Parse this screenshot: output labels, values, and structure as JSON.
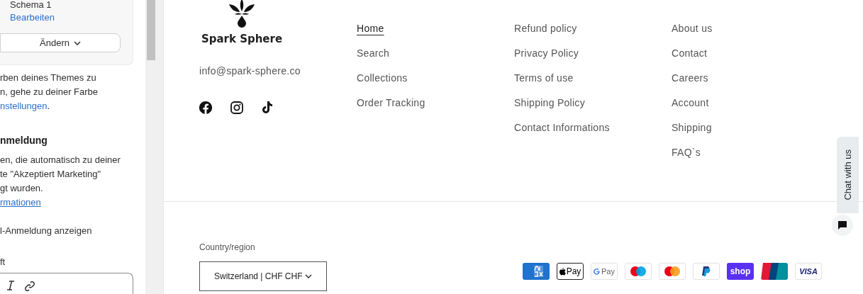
{
  "editor_panel": {
    "card": {
      "title": "Schema 1",
      "edit_link": "Bearbeiten",
      "change_button": "Ändern"
    },
    "paragraph_1": {
      "lines": [
        "rben deines Themes zu",
        "n, gehe zu deiner Farbe"
      ],
      "link": "nstellungen",
      "tail": "."
    },
    "heading": "nmeldung",
    "paragraph_2": {
      "lines": [
        "en, die automatisch zu deiner",
        "te \"Akzeptiert Marketing\"",
        "gt wurden."
      ],
      "link": "rmationen"
    },
    "option_label": "l-Anmeldung anzeigen",
    "field_label": "ft",
    "toolbar": [
      {
        "kind": "italic"
      },
      {
        "kind": "link"
      }
    ]
  },
  "footer": {
    "brand": "Spark Sphere",
    "email": "info@spark-sphere.co",
    "social": [
      {
        "kind": "facebook"
      },
      {
        "kind": "instagram"
      },
      {
        "kind": "tiktok"
      }
    ],
    "menus": [
      {
        "links": [
          {
            "label": "Home",
            "selected": true
          },
          {
            "label": "Search",
            "selected": false
          },
          {
            "label": "Collections",
            "selected": false
          },
          {
            "label": "Order Tracking",
            "selected": false
          }
        ]
      },
      {
        "links": [
          {
            "label": "Refund policy",
            "selected": false
          },
          {
            "label": "Privacy Policy",
            "selected": false
          },
          {
            "label": "Terms of use",
            "selected": false
          },
          {
            "label": "Shipping Policy",
            "selected": false
          },
          {
            "label": "Contact Informations",
            "selected": false
          }
        ]
      },
      {
        "links": [
          {
            "label": "About us",
            "selected": false
          },
          {
            "label": "Contact",
            "selected": false
          },
          {
            "label": "Careers",
            "selected": false
          },
          {
            "label": "Account",
            "selected": false
          },
          {
            "label": "Shipping",
            "selected": false
          },
          {
            "label": "FAQ`s",
            "selected": false
          }
        ]
      }
    ],
    "country_label": "Country/region",
    "country_value": "Switzerland | CHF CHF",
    "payments": [
      {
        "kind": "amex"
      },
      {
        "kind": "apple_pay",
        "label": "Pay"
      },
      {
        "kind": "google_pay",
        "label": "Pay"
      },
      {
        "kind": "maestro"
      },
      {
        "kind": "mastercard"
      },
      {
        "kind": "paypal"
      },
      {
        "kind": "shop",
        "label": "shop"
      },
      {
        "kind": "unionpay"
      },
      {
        "kind": "visa",
        "label": "VISA"
      }
    ]
  },
  "chat": {
    "label": "Chat with us"
  }
}
